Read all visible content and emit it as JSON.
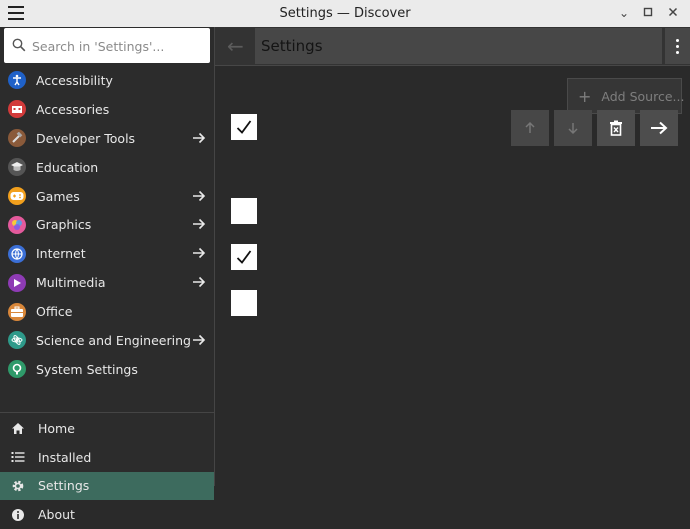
{
  "window": {
    "title": "Settings — Discover",
    "menu_icon": "hamburger-icon",
    "controls": [
      "minimize-icon",
      "maximize-icon",
      "close-icon"
    ]
  },
  "search": {
    "placeholder": "Search in 'Settings'..."
  },
  "categories": [
    {
      "label": "Accessibility",
      "icon": "accessibility-icon",
      "color": "#1f61c8",
      "has_submenu": false
    },
    {
      "label": "Accessories",
      "icon": "accessories-icon",
      "color": "#d23b3b",
      "has_submenu": false
    },
    {
      "label": "Developer Tools",
      "icon": "developer-tools-icon",
      "color": "#8a5a3a",
      "has_submenu": true
    },
    {
      "label": "Education",
      "icon": "graduation-cap-icon",
      "color": "#555555",
      "has_submenu": false
    },
    {
      "label": "Games",
      "icon": "gamepad-icon",
      "color": "#f2a01d",
      "has_submenu": true
    },
    {
      "label": "Graphics",
      "icon": "graphics-icon",
      "color": "#e45a9c",
      "has_submenu": true
    },
    {
      "label": "Internet",
      "icon": "globe-icon",
      "color": "#3b6fd6",
      "has_submenu": true
    },
    {
      "label": "Multimedia",
      "icon": "multimedia-icon",
      "color": "#8e3bb5",
      "has_submenu": true
    },
    {
      "label": "Office",
      "icon": "briefcase-icon",
      "color": "#d9873a",
      "has_submenu": false
    },
    {
      "label": "Science and Engineering",
      "icon": "science-icon",
      "color": "#2e9a8a",
      "has_submenu": true
    },
    {
      "label": "System Settings",
      "icon": "system-settings-icon",
      "color": "#2f9a6a",
      "has_submenu": false
    }
  ],
  "nav": [
    {
      "label": "Home",
      "icon": "home-icon",
      "active": false
    },
    {
      "label": "Installed",
      "icon": "list-icon",
      "active": false
    },
    {
      "label": "Settings",
      "icon": "gear-icon",
      "active": true
    },
    {
      "label": "About",
      "icon": "info-icon",
      "active": false
    }
  ],
  "header": {
    "title": "Settings",
    "back_icon": "back-arrow-icon",
    "more_icon": "kebab-menu-icon"
  },
  "toolbar": {
    "add_source_label": "Add Source...",
    "move_up_icon": "arrow-up-icon",
    "move_down_icon": "arrow-down-icon",
    "delete_icon": "trash-icon",
    "forward_icon": "arrow-right-icon"
  },
  "sources": [
    {
      "checked": true
    },
    {
      "checked": false
    },
    {
      "checked": true
    },
    {
      "checked": false
    }
  ],
  "colors": {
    "accent": "#3d6b5e",
    "background": "#2a2a2a"
  }
}
